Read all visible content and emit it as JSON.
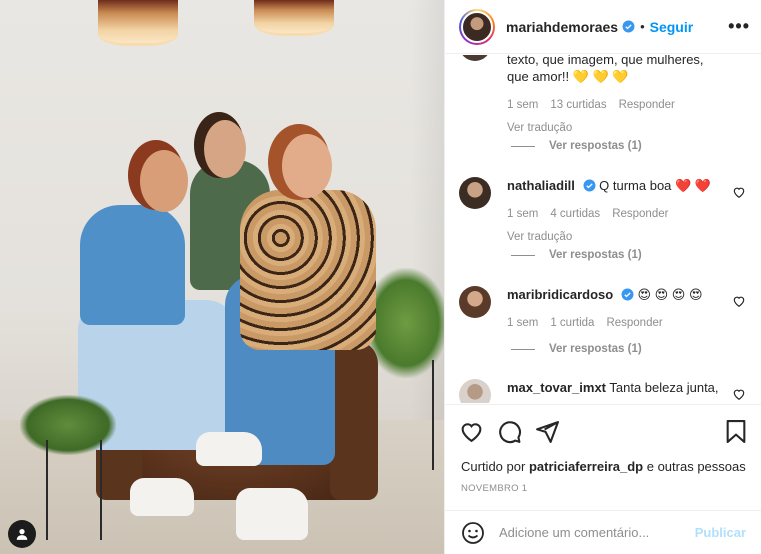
{
  "header": {
    "username": "mariahdemoraes",
    "separator": "•",
    "follow_label": "Seguir",
    "more_label": "•••"
  },
  "comments": {
    "partial": {
      "text_line1": "texto, que imagem, que mulheres,",
      "text_line2": "que amor!! 💛 💛 💛",
      "time": "1 sem",
      "likes": "13 curtidas",
      "reply": "Responder",
      "translate": "Ver tradução",
      "view_replies": "Ver respostas (1)"
    },
    "items": [
      {
        "username": "nathaliadill",
        "verified": true,
        "text": "Q turma boa ❤️ ❤️",
        "time": "1 sem",
        "likes": "4 curtidas",
        "reply": "Responder",
        "translate": "Ver tradução",
        "view_replies": "Ver respostas (1)"
      },
      {
        "username": "maribridicardoso",
        "verified": true,
        "text": "😍 😍 😍 😍",
        "time": "1 sem",
        "likes": "1 curtida",
        "reply": "Responder",
        "view_replies": "Ver respostas (1)"
      },
      {
        "username": "max_tovar_imxt",
        "text": "Tanta beleza junta,"
      }
    ]
  },
  "actions": {
    "liked_prefix": "Curtido por",
    "liked_user": "patriciaferreira_dp",
    "liked_suffix": "e outras pessoas",
    "date": "NOVEMBRO 1"
  },
  "add_comment": {
    "placeholder": "Adicione um comentário...",
    "publish_label": "Publicar"
  },
  "colors": {
    "link_blue": "#0095f6",
    "verified_blue": "#3897f0",
    "muted": "#8e8e8e",
    "heart_red": "#ed4956"
  },
  "icons": [
    "heart-icon",
    "comment-icon",
    "share-icon",
    "bookmark-icon",
    "emoji-icon",
    "verified-icon",
    "user-tag-icon"
  ]
}
